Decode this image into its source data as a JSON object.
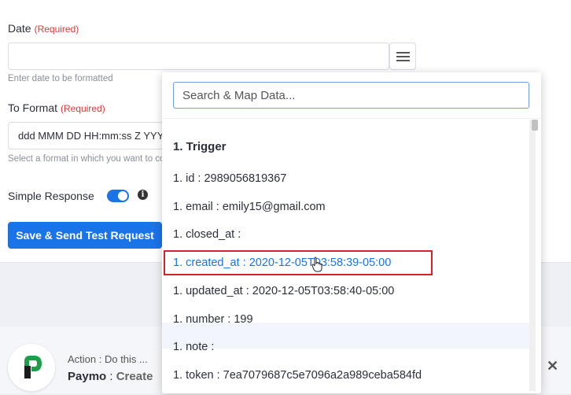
{
  "form": {
    "date_label": "Date",
    "required": "(Required)",
    "date_value": "",
    "date_hint": "Enter date to be formatted",
    "to_format_label": "To Format",
    "to_format_value": "ddd MMM DD HH:mm:ss Z YYYY",
    "to_format_hint": "Select a format in which you want to convert the date",
    "simple_response_label": "Simple Response",
    "simple_response_on": true,
    "info_glyph": "i",
    "save_button": "Save & Send Test Request"
  },
  "action": {
    "label": "Action : Do this ...",
    "app": "Paymo",
    "event": "Create",
    "close_glyph": "✕"
  },
  "dropdown": {
    "search_placeholder": "Search & Map Data...",
    "section_title": "1. Trigger",
    "items": [
      "1. id : 2989056819367",
      "1. email : emily15@gmail.com",
      "1. closed_at :",
      "1. created_at : 2020-12-05T03:58:39-05:00",
      "1. updated_at : 2020-12-05T03:58:40-05:00",
      "1. number : 199",
      "1. note :",
      "1. token : 7ea7079687c5e7096a2a989ceba584fd"
    ],
    "selected_index": 3
  },
  "colors": {
    "accent": "#1b73e8",
    "required": "#d23c3c",
    "highlight_box": "#d6212a",
    "logo_green": "#1e9e4a"
  }
}
